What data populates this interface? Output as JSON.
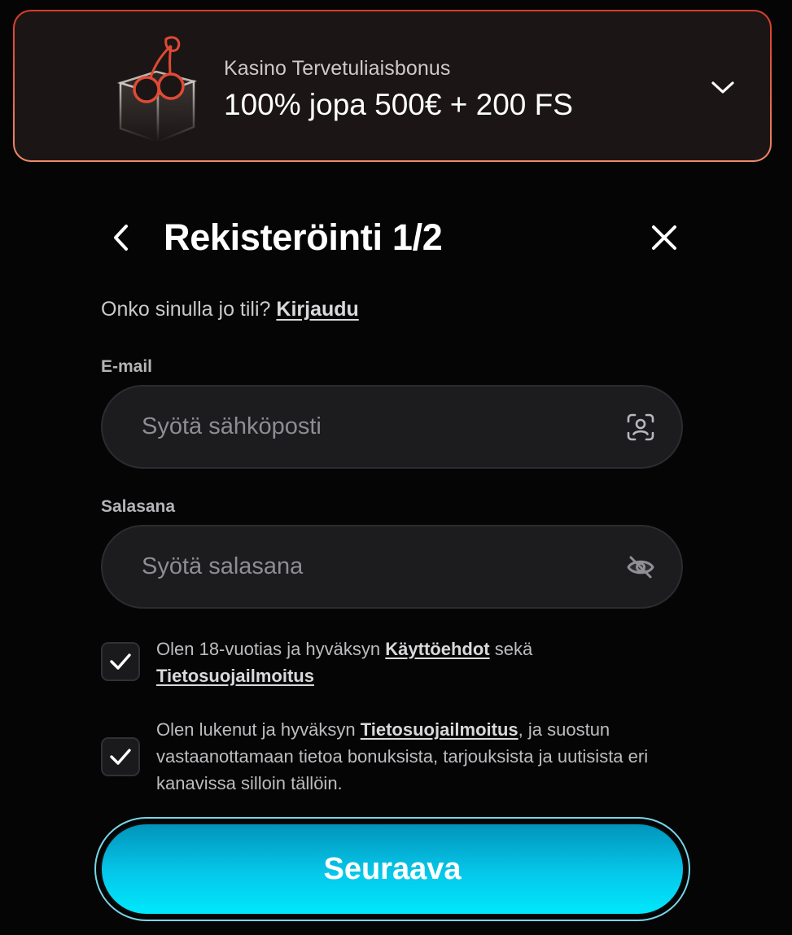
{
  "bonus": {
    "subtitle": "Kasino Tervetuliaisbonus",
    "title": "100% jopa 500€ + 200 FS",
    "icon": "cherry-box-icon",
    "toggle_icon": "chevron-down-icon",
    "accent_color": "#e2452f"
  },
  "header": {
    "title": "Rekisteröinti 1/2",
    "back_icon": "chevron-left-icon",
    "close_icon": "close-icon"
  },
  "login_prompt": {
    "text": "Onko sinulla jo tili? ",
    "link": "Kirjaudu"
  },
  "email": {
    "label": "E-mail",
    "placeholder": "Syötä sähköposti",
    "value": "",
    "icon": "face-scan-icon"
  },
  "password": {
    "label": "Salasana",
    "placeholder": "Syötä salasana",
    "value": "",
    "icon": "eye-off-icon"
  },
  "consents": [
    {
      "checked": true,
      "text_before": "Olen 18-vuotias ja hyväksyn ",
      "link1": "Käyttöehdot",
      "text_middle": " sekä ",
      "link2": "Tietosuojailmoitus",
      "text_after": ""
    },
    {
      "checked": true,
      "text_before": "Olen lukenut ja hyväksyn ",
      "link1": "Tietosuojailmoitus",
      "text_after": ", ja suostun vastaanottamaan tietoa bonuksista, tarjouksista ja uutisista eri kanavissa silloin tällöin."
    }
  ],
  "next_button": {
    "label": "Seuraava",
    "color": "#05c8ea"
  }
}
